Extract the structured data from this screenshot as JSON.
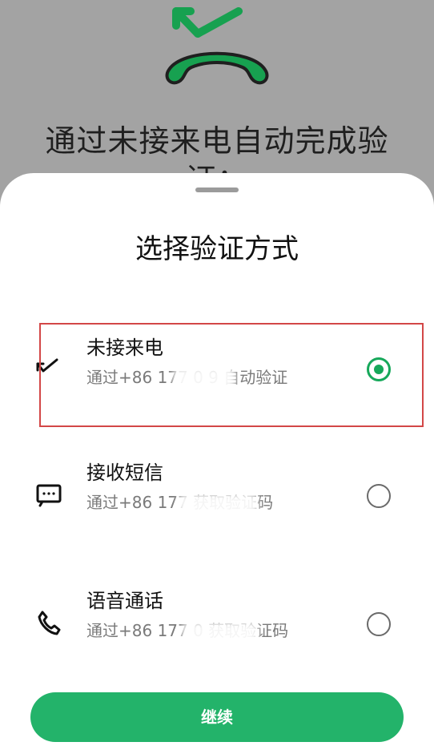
{
  "header": {
    "title_text": "通过未接来电自动完成验",
    "title_continuation": "证："
  },
  "sheet": {
    "title": "选择验证方式",
    "options": [
      {
        "title": "未接来电",
        "description": "通过+86 177 0 9 自动验证",
        "selected": true,
        "icon": "missed-call-icon"
      },
      {
        "title": "接收短信",
        "description": "通过+86 177 获取验证码",
        "selected": false,
        "icon": "message-icon"
      },
      {
        "title": "语音通话",
        "description": "通过+86 177 0 获取验证码",
        "selected": false,
        "icon": "phone-icon"
      }
    ],
    "continue_label": "继续"
  },
  "colors": {
    "accent": "#23b36a",
    "selected_radio": "#16a85a",
    "highlight_border": "#d34747",
    "background_dim": "#a3a3a3"
  }
}
